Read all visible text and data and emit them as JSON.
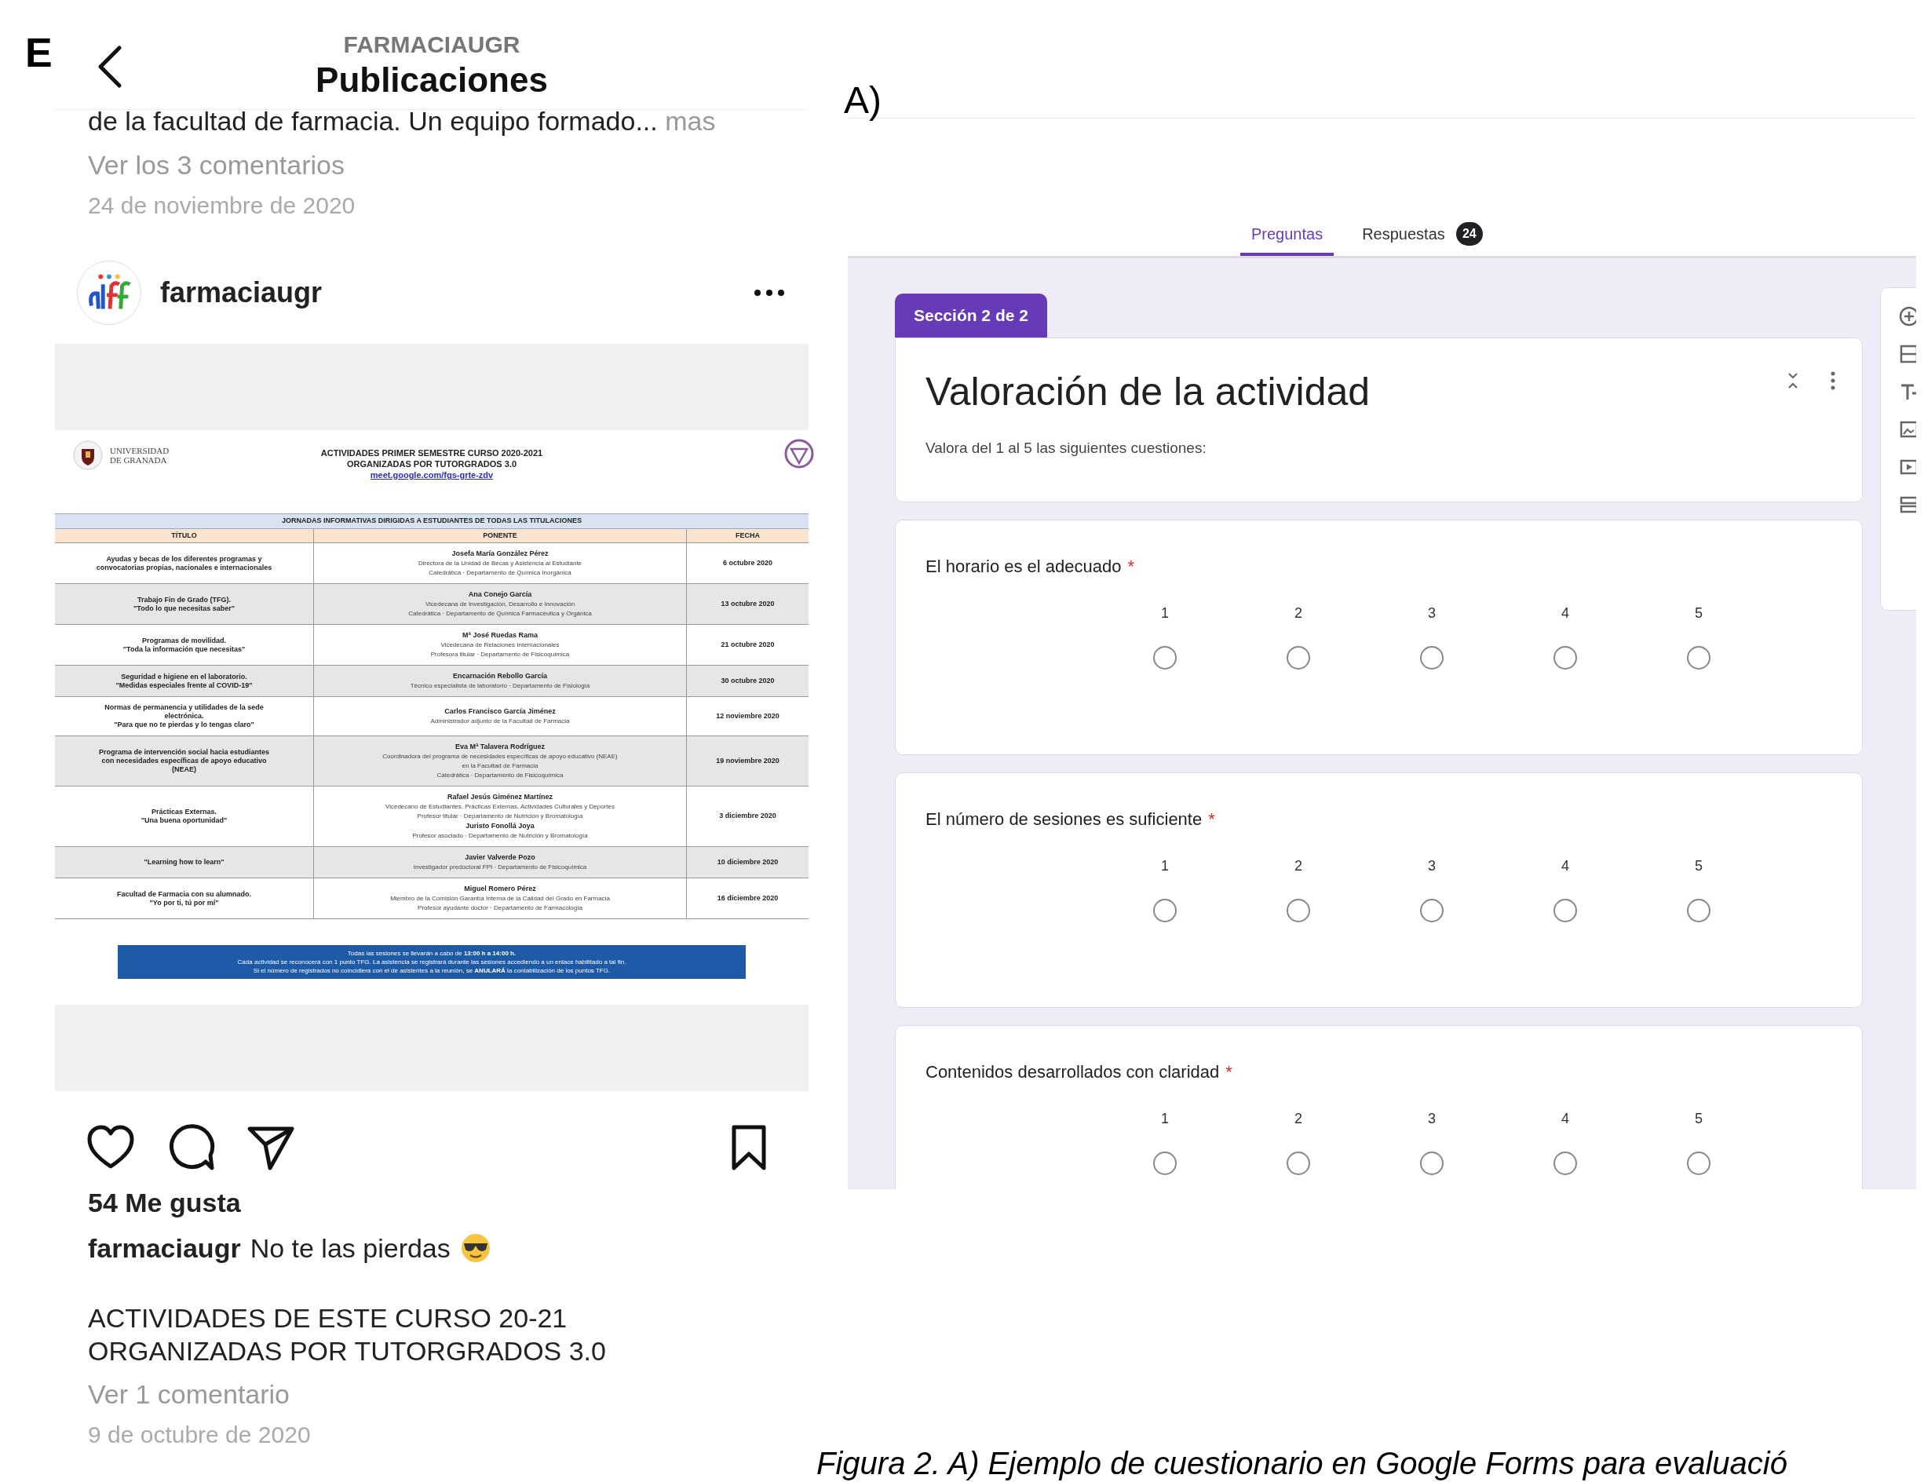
{
  "panel_e": {
    "label": "E",
    "header": {
      "account": "FARMACIAUGR",
      "title": "Publicaciones"
    },
    "previous_post": {
      "caption_tail": "de la facultad de farmacia. Un equipo formado...",
      "more": "mas",
      "comments_link": "Ver los 3 comentarios",
      "date": "24 de noviembre de 2020"
    },
    "post": {
      "username": "farmaciaugr",
      "document": {
        "university": [
          "UNIVERSIDAD",
          "DE GRANADA"
        ],
        "title_lines": [
          "ACTIVIDADES PRIMER SEMESTRE CURSO 2020-2021",
          "ORGANIZADAS POR TUTORGRADOS 3.0"
        ],
        "link": "meet.google.com/fgs-grte-zdv",
        "section": "JORNADAS INFORMATIVAS DIRIGIDAS A ESTUDIANTES DE TODAS LAS TITULACIONES",
        "columns": [
          "TÍTULO",
          "PONENTE",
          "FECHA"
        ],
        "rows": [
          {
            "title": [
              "Ayudas y becas de los diferentes programas y",
              "convocatorias propias, nacionales e internacionales"
            ],
            "speakers": [
              {
                "name": "Josefa María González Pérez",
                "roles": [
                  "Directora de la Unidad de Becas y Asistencia al Estudiante",
                  "Catedrática · Departamento de Química Inorgánica"
                ]
              }
            ],
            "date": "6 octubre 2020"
          },
          {
            "title": [
              "Trabajo Fin de Grado (TFG).",
              "\"Todo lo que necesitas saber\""
            ],
            "speakers": [
              {
                "name": "Ana Conejo García",
                "roles": [
                  "Vicedecana de Investigación, Desarrollo e Innovación",
                  "Catedrática · Departamento de Química Farmacéutica y Orgánica"
                ]
              }
            ],
            "date": "13 octubre 2020"
          },
          {
            "title": [
              "Programas de movilidad.",
              "\"Toda la información que necesitas\""
            ],
            "speakers": [
              {
                "name": "Mª José Ruedas Rama",
                "roles": [
                  "Vicedecana de Relaciones Internacionales",
                  "Profesora titular · Departamento de Fisicoquímica"
                ]
              }
            ],
            "date": "21 octubre 2020"
          },
          {
            "title": [
              "Seguridad e higiene en el laboratorio.",
              "\"Medidas especiales frente al COVID-19\""
            ],
            "speakers": [
              {
                "name": "Encarnación Rebollo García",
                "roles": [
                  "Técnico especialista de laboratorio · Departamento de Fisiología"
                ]
              }
            ],
            "date": "30 octubre 2020"
          },
          {
            "title": [
              "Normas de permanencia y utilidades de la sede",
              "electrónica.",
              "\"Para que no te pierdas y lo tengas claro\""
            ],
            "speakers": [
              {
                "name": "Carlos Francisco García Jiménez",
                "roles": [
                  "Administrador adjunto de la Facultad de Farmacia"
                ]
              }
            ],
            "date": "12 noviembre 2020"
          },
          {
            "title": [
              "Programa de intervención social hacia estudiantes",
              "con necesidades específicas de apoyo educativo",
              "(NEAE)"
            ],
            "speakers": [
              {
                "name": "Eva Mª Talavera Rodríguez",
                "roles": [
                  "Coordinadora del programa de necesidades específicas de apoyo educativo (NEAE)",
                  "en la Facultad de Farmacia",
                  "Catedrática · Departamento de Fisicoquímica"
                ]
              }
            ],
            "date": "19 noviembre 2020"
          },
          {
            "title": [
              "Prácticas Externas.",
              "\"Una buena oportunidad\""
            ],
            "speakers": [
              {
                "name": "Rafael Jesús Giménez Martínez",
                "roles": [
                  "Vicedecano de Estudiantes, Prácticas Externas, Actividades Culturales y Deportes",
                  "Profesor titular · Departamento de Nutrición y Bromatología"
                ]
              },
              {
                "name": "Juristo Fonollá Joya",
                "roles": [
                  "Profesor asociado · Departamento de Nutrición y Bromatología"
                ]
              }
            ],
            "date": "3 diciembre 2020"
          },
          {
            "title": [
              "\"Learning how to learn\""
            ],
            "speakers": [
              {
                "name": "Javier Valverde Pozo",
                "roles": [
                  "Investigador predoctoral FPI · Departamento de Fisicoquímica"
                ]
              }
            ],
            "date": "10 diciembre 2020"
          },
          {
            "title": [
              "Facultad de Farmacia con su alumnado.",
              "\"Yo por ti, tú por mí\""
            ],
            "speakers": [
              {
                "name": "Miguel Romero Pérez",
                "roles": [
                  "Miembro de la Comisión Garantía Interna de la Calidad del Grado en Farmacia",
                  "Profesor ayudante doctor · Departamento de Farmacología"
                ]
              }
            ],
            "date": "16 diciembre 2020"
          }
        ],
        "notice": [
          "Todas las sesiones se llevarán a cabo de **13:00 h a 14:00 h.**",
          "Cada actividad se reconocerá con 1 punto TFG. La asistencia se registrará durante las sesiones accediendo a un enlace habilitado a tal fin.",
          "Si el número de registrados no coincidiera con el de asistentes a la reunión, se **ANULARÁ** la contabilización de los puntos TFG."
        ]
      },
      "likes": "54 Me gusta",
      "caption_user": "farmaciaugr",
      "caption_text": "No te las pierdas",
      "caption_body": [
        "ACTIVIDADES DE ESTE CURSO 20-21",
        "ORGANIZADAS POR TUTORGRADOS 3.0"
      ],
      "comments_link": "Ver 1 comentario",
      "date": "9 de octubre de 2020"
    }
  },
  "panel_a": {
    "label": "A)",
    "tabs": [
      {
        "label": "Preguntas",
        "selected": true
      },
      {
        "label": "Respuestas",
        "selected": false,
        "badge": "24"
      }
    ],
    "section_badge": "Sección 2 de 2",
    "title": "Valoración de la actividad",
    "description": "Valora del 1 al 5 las siguientes cuestiones:",
    "questions": [
      {
        "text": "El horario es el adecuado",
        "required_mark": "*",
        "options": [
          {
            "label": "1",
            "selected": false
          },
          {
            "label": "2",
            "selected": false
          },
          {
            "label": "3",
            "selected": false
          },
          {
            "label": "4",
            "selected": false
          },
          {
            "label": "5",
            "selected": false
          }
        ]
      },
      {
        "text": "El número de sesiones es suficiente",
        "required_mark": "*",
        "options": [
          {
            "label": "1",
            "selected": false
          },
          {
            "label": "2",
            "selected": false
          },
          {
            "label": "3",
            "selected": false
          },
          {
            "label": "4",
            "selected": false
          },
          {
            "label": "5",
            "selected": false
          }
        ]
      },
      {
        "text": "Contenidos desarrollados con claridad",
        "required_mark": "*",
        "options": [
          {
            "label": "1",
            "selected": false
          },
          {
            "label": "2",
            "selected": false
          },
          {
            "label": "3",
            "selected": false
          },
          {
            "label": "4",
            "selected": false
          },
          {
            "label": "5",
            "selected": false
          }
        ]
      }
    ]
  },
  "caption": "Figura 2. A) Ejemplo de cuestionario en Google Forms para evaluació"
}
